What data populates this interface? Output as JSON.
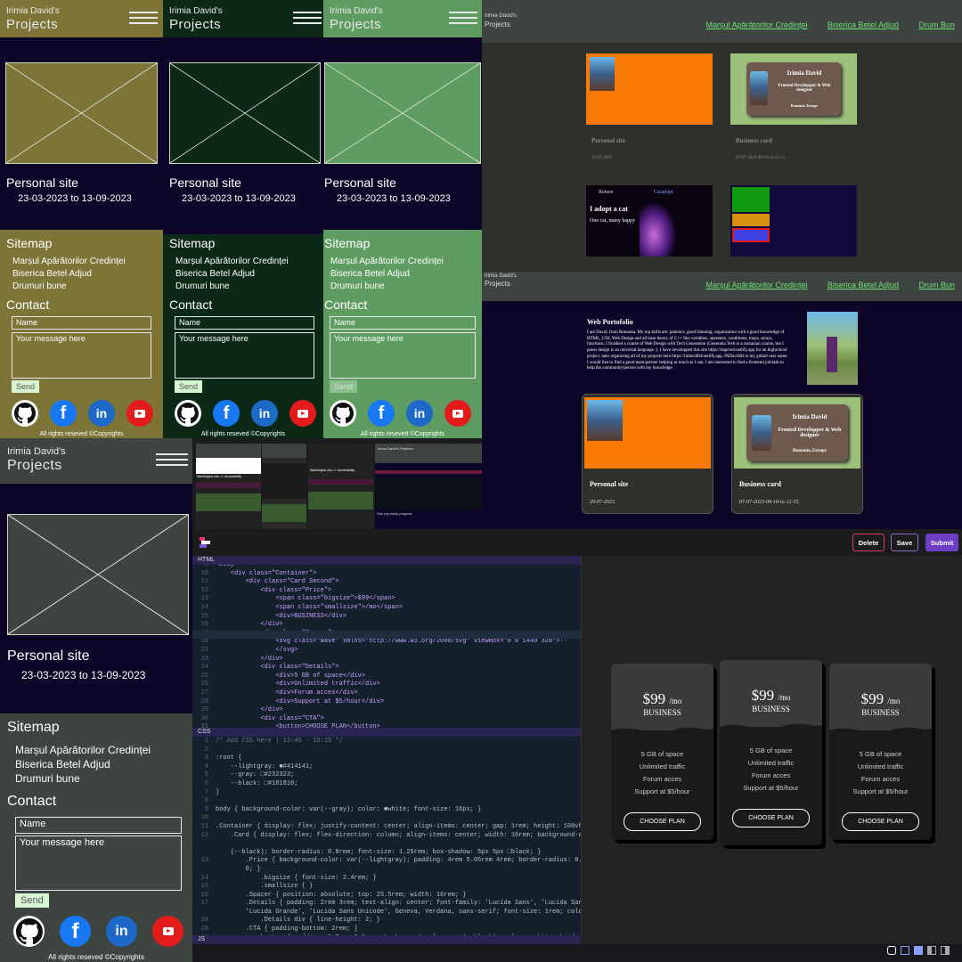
{
  "colors": {
    "bg": "#0d0628",
    "olive": "#7c7537",
    "forest": "#0c2816",
    "mint": "#5f9c62",
    "slate": "#3e4440",
    "accent": "#6fe07a",
    "purple": "#6e3fc6"
  },
  "icons": [
    "hamburger-icon",
    "image-placeholder-icon",
    "github-icon",
    "facebook-icon",
    "linkedin-icon",
    "youtube-icon",
    "dev-logo-icon",
    "dot-icon"
  ],
  "site": {
    "owner": "Irimia David's",
    "title": "Projects",
    "project_name": "Personal site",
    "project_dates": "23-03-2023 to 13-09-2023",
    "sitemap_title": "Sitemap",
    "sitemap_items": [
      "Marșul Apărătorilor Credinței",
      "Biserica Betel Adjud",
      "Drumuri bune"
    ],
    "contact_title": "Contact",
    "name_placeholder": "Name",
    "message_placeholder": "Your message here",
    "send_label": "Send",
    "copyright": "All rights reseved ©Copyrights",
    "github": "",
    "facebook": "f",
    "linkedin": "in"
  },
  "desktop": {
    "owner": "Irimia David's",
    "title": "Projects",
    "nav": [
      "Marșul Apărătorilor Credinței",
      "Biserica Betel Adjud",
      "Drum Bun"
    ],
    "cards": [
      {
        "name": "Personal site",
        "date": "29-07-2023"
      },
      {
        "name": "Business card",
        "date": "07-07-2023-09-10-to-12-55"
      }
    ],
    "business_name": "Irimia David",
    "business_role": "Fronted Developper & Web designer",
    "business_loc": "Romania, Europe",
    "adopt_back": "Return",
    "adopt_brand": "Catadopt",
    "adopt_title": "I adopt a cat",
    "adopt_sub": "One cat, many happy",
    "portfolio_title": "Web Portofolio",
    "portfolio_text": "I am David, from Romania. My top skills are: patience, good listening, organization with a good knowledge of HTML, CSS, Web Design and all base theory of C++ like variables, operators, conditions, loops, arrays, functions. I finished a course of Web Design with Tech Generation (Generatia Tech is a romanian course, but I guess design is an universal language :). I have developped this site https://dapcred.netlify.app for an highschool project, later organizing all of my projects here https://indavid04.netlify.app, INDavid04 is my github user name. I would like to find a good team/partner helping as much as I can. I am interested to find a frontend job/task to help the community/person with my knowledge."
  },
  "thumbs": {
    "header": "Washington.edu >> Accessibility",
    "projects": "Irimia David's Projects",
    "tail": "See my study projects"
  },
  "editor": {
    "buttons": {
      "delete": "Delete",
      "save": "Save",
      "submit": "Submit"
    },
    "html_tab": "HTML",
    "css_tab": "CSS",
    "js_tab": "JS",
    "html_lines": [
      [
        "9",
        "<body>"
      ],
      [
        "10",
        "    <div class=\"Container\">"
      ],
      [
        "11",
        "        <div class=\"Card Second\">"
      ],
      [
        "12",
        "            <div class=\"Price\">"
      ],
      [
        "13",
        "                <span class=\"bigsize\">$99</span>"
      ],
      [
        "14",
        "                <span class=\"smallsize\">/mo</span>"
      ],
      [
        "15",
        "                <div>BUSINESS</div>"
      ],
      [
        "16",
        "            </div>"
      ],
      [
        "17",
        "            <div class=\"Spacer\">"
      ],
      [
        "18",
        "                <svg class=\"Wave\" xmlns=\"http://www.w3.org/2000/svg\" viewBox=\"0 0 1440 320\">··"
      ],
      [
        "22",
        "                </svg>"
      ],
      [
        "23",
        "            </div>"
      ],
      [
        "24",
        "            <div class=\"Details\">"
      ],
      [
        "25",
        "                <div>5 GB of space</div>"
      ],
      [
        "26",
        "                <div>Unlimited traffic</div>"
      ],
      [
        "27",
        "                <div>Forum acces</div>"
      ],
      [
        "28",
        "                <div>Support at $5/hour</div>"
      ],
      [
        "29",
        "            </div>"
      ],
      [
        "30",
        "            <div class=\"CTA\">"
      ],
      [
        "31",
        "                <button>CHOOSE PLAN</button>"
      ],
      [
        "32",
        "            </div>"
      ]
    ],
    "css_lines": [
      [
        "1",
        "/* Add CSS here | 13:45 - 15:15 */"
      ],
      [
        "2",
        ""
      ],
      [
        "3",
        ":root {"
      ],
      [
        "4",
        "    --lightgray: ■#414141;"
      ],
      [
        "5",
        "    --gray: □#232323;"
      ],
      [
        "6",
        "    --black: □#181818;"
      ],
      [
        "7",
        "}"
      ],
      [
        "8",
        ""
      ],
      [
        "9",
        "body { background-color: var(--gray); color: ■white; font-size: 16px; }"
      ],
      [
        "10",
        ""
      ],
      [
        "11",
        ".Container { display: flex; justify-content: center; align-items: center; gap: 1rem; height: 100vh; }"
      ],
      [
        "12",
        "    .Card { display: flex; flex-direction: column; align-items: center; width: 16rem; background-color: var"
      ],
      [
        "",
        ""
      ],
      [
        "",
        "    (--black); border-radius: 0.8rem; font-size: 1.25rem; box-shadow: 5px 5px □black; }"
      ],
      [
        "13",
        "        .Price { background-color: var(--lightgray); padding: 4rem 5.05rem 4rem; border-radius: 0.8rem 0.8rem 0"
      ],
      [
        "",
        "        0; }"
      ],
      [
        "14",
        "            .bigsize { font-size: 2.4rem; }"
      ],
      [
        "15",
        "            .smallsize { }"
      ],
      [
        "16",
        "        .Spacer { position: absolute; top: 25.5rem; width: 16rem; }"
      ],
      [
        "17",
        "        .Details { padding: 2rem 3rem; text-align: center; font-family: 'Lucida Sans', 'Lucida Sans Regular',"
      ],
      [
        "",
        "        'Lucida Grande', 'Lucida Sans Unicode', Geneva, Verdana, sans-serif; font-size: 1rem; color: ■#9a9a9a; }"
      ],
      [
        "18",
        "            .Details div { line-height: 2; }"
      ],
      [
        "19",
        "        .CTA { padding-bottom: 2rem; }"
      ],
      [
        "20",
        "            button { padding: 0.8rem 2.5rem; background-color: var(--black); color: ■white; border: none;"
      ],
      [
        "",
        "            border-radius: 1.5rem; border: 2px solid ■azure; color: pointer; }"
      ],
      [
        "21",
        "    .Second { height: 28rem; }"
      ],
      [
        "22",
        "    .Card.Second .Spacer { top: 26rem; }"
      ]
    ],
    "plans": [
      {
        "price": "$99",
        "per": "/mo",
        "tier": "BUSINESS",
        "features": [
          "5 GB of space",
          "Unlimited traffic",
          "Forum acces",
          "Support at $5/hour"
        ],
        "cta": "CHOOSE PLAN"
      },
      {
        "price": "$99",
        "per": "/mo",
        "tier": "BUSINESS",
        "features": [
          "5 GB of space",
          "Unlimited traffic",
          "Forum acces",
          "Support at $5/hour"
        ],
        "cta": "CHOOSE PLAN"
      },
      {
        "price": "$99",
        "per": "/mo",
        "tier": "BUSINESS",
        "features": [
          "5 GB of space",
          "Unlimited traffic",
          "Forum acces",
          "Support at $5/hour"
        ],
        "cta": "CHOOSE PLAN"
      }
    ]
  }
}
